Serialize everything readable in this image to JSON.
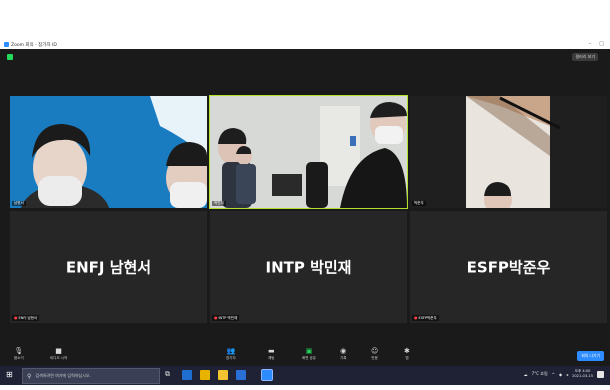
{
  "window": {
    "title": "Zoom 회의 - 참가자 ID",
    "controls": [
      "–",
      "□"
    ],
    "view_button": "갤러리 보기"
  },
  "tiles": [
    {
      "id": "tile1",
      "name_tag": "남현서",
      "has_video": true,
      "muted": false
    },
    {
      "id": "tile2",
      "name_tag": "박민재",
      "has_video": true,
      "muted": false,
      "active_speaker": true
    },
    {
      "id": "tile3",
      "name_tag": "박준우",
      "has_video": true,
      "muted": false
    },
    {
      "id": "tile4",
      "display_name": "ENFJ 남현서",
      "name_tag": "ENFJ 남현서",
      "has_video": false,
      "muted": true
    },
    {
      "id": "tile5",
      "display_name": "INTP 박민재",
      "name_tag": "INTP 박민재",
      "has_video": false,
      "muted": true
    },
    {
      "id": "tile6",
      "display_name": "ESFP박준우",
      "name_tag": "ESFP박준우",
      "has_video": false,
      "muted": true
    }
  ],
  "toolbar": {
    "left": [
      {
        "name": "mute-button",
        "icon": "microphone-icon",
        "label": "음소거"
      },
      {
        "name": "start-video-button",
        "icon": "video-camera-icon",
        "label": "비디오 시작"
      }
    ],
    "center": [
      {
        "name": "participants-button",
        "icon": "participants-icon",
        "label": "참가자"
      },
      {
        "name": "chat-button",
        "icon": "chat-icon",
        "label": "채팅"
      },
      {
        "name": "share-screen-button",
        "icon": "share-screen-icon",
        "label": "화면 공유"
      },
      {
        "name": "record-button",
        "icon": "record-icon",
        "label": "기록"
      },
      {
        "name": "reactions-button",
        "icon": "reactions-icon",
        "label": "반응"
      },
      {
        "name": "apps-button",
        "icon": "apps-icon",
        "label": "앱"
      }
    ],
    "end_button": "회의 나가기"
  },
  "taskbar": {
    "search_placeholder": "검색하려면 여기에 입력하십시오.",
    "weather": "7°C 흐림",
    "time": "오후 4:00",
    "date": "2021-03-15",
    "colors": {
      "accent": "#2d8cff",
      "unmute": "#23d959",
      "muted": "#ff4040"
    }
  }
}
